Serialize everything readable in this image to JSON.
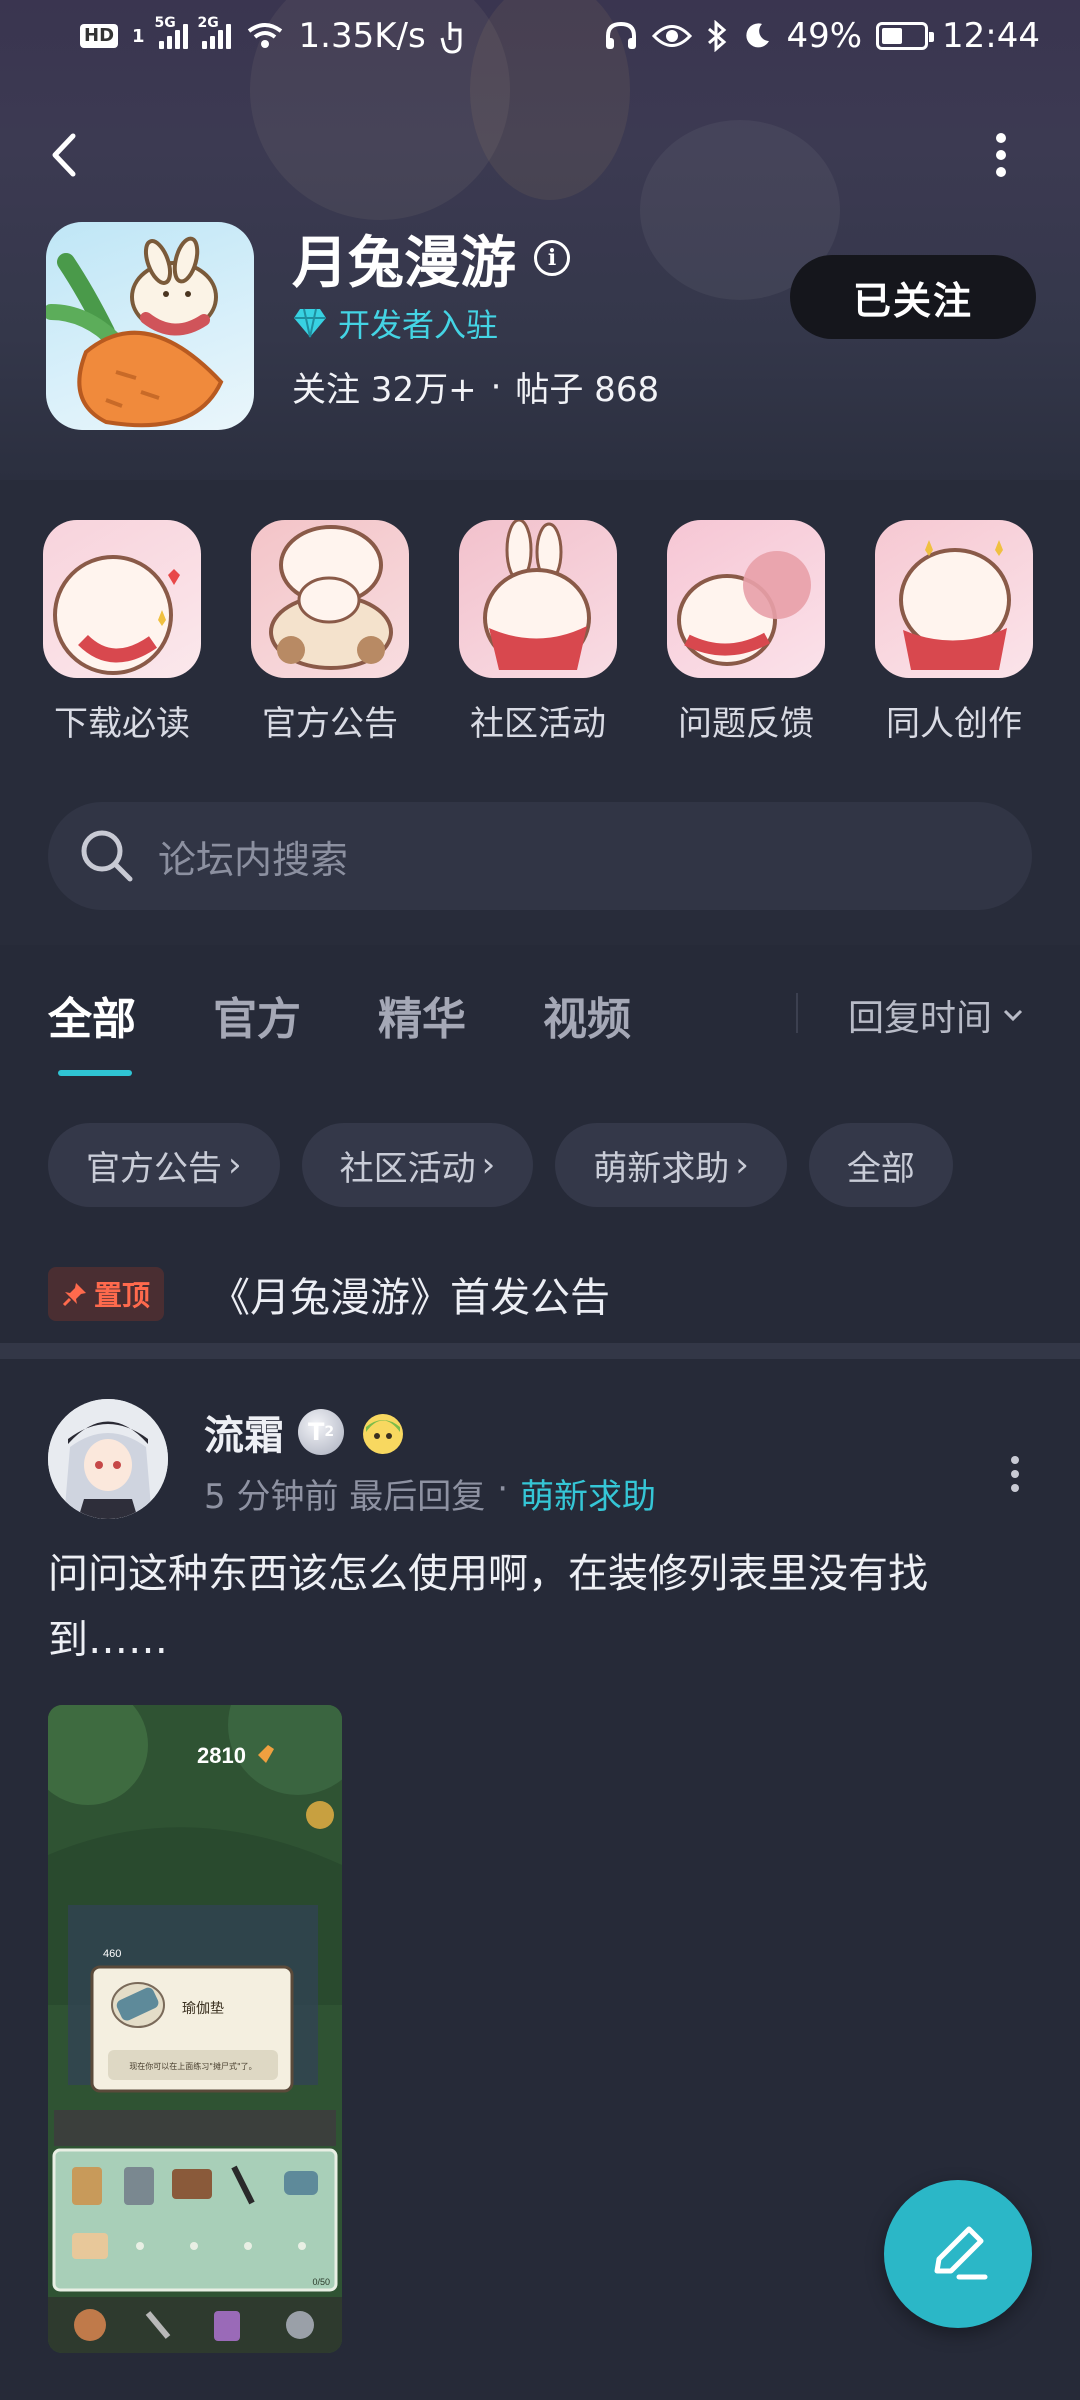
{
  "status_bar": {
    "hd": "HD",
    "sim": "1",
    "net1": "5G",
    "net2": "2G",
    "speed": "1.35K/s",
    "battery": "49%",
    "battery_level": 0.49,
    "time": "12:44"
  },
  "header": {
    "app_name": "月兔漫游",
    "developer_tag": "开发者入驻",
    "stats": {
      "followers": "关注 32万+",
      "separator": "·",
      "posts": "帖子 868"
    },
    "follow_button": "已关注"
  },
  "shortcuts": [
    {
      "label": "下载必读"
    },
    {
      "label": "官方公告"
    },
    {
      "label": "社区活动"
    },
    {
      "label": "问题反馈"
    },
    {
      "label": "同人创作"
    }
  ],
  "search": {
    "placeholder": "论坛内搜索"
  },
  "tabs": [
    {
      "label": "全部",
      "active": true
    },
    {
      "label": "官方",
      "active": false
    },
    {
      "label": "精华",
      "active": false
    },
    {
      "label": "视频",
      "active": false
    }
  ],
  "sort": {
    "label": "回复时间"
  },
  "chips": [
    {
      "label": "官方公告",
      "chevron": "›"
    },
    {
      "label": "社区活动",
      "chevron": "›"
    },
    {
      "label": "萌新求助",
      "chevron": "›"
    },
    {
      "label": "全部",
      "chevron": ""
    }
  ],
  "pinned": {
    "badge": "置顶",
    "title": "《月兔漫游》首发公告"
  },
  "post": {
    "author": "流霜",
    "level": "T",
    "level_sub": "2",
    "time": "5 分钟前 最后回复",
    "separator": "·",
    "tag": "萌新求助",
    "text": "问问这种东西该怎么使用啊，在装修列表里没有找到……",
    "image": {
      "carrot_count": "2810",
      "energy": "460",
      "item_name": "瑜伽垫",
      "item_desc": "现在你可以在上面练习\"摊尸式\"了。",
      "slots": "0/50"
    }
  },
  "colors": {
    "accent": "#2fc4d4",
    "pin": "#ff6a4d",
    "background": "#262a38"
  }
}
